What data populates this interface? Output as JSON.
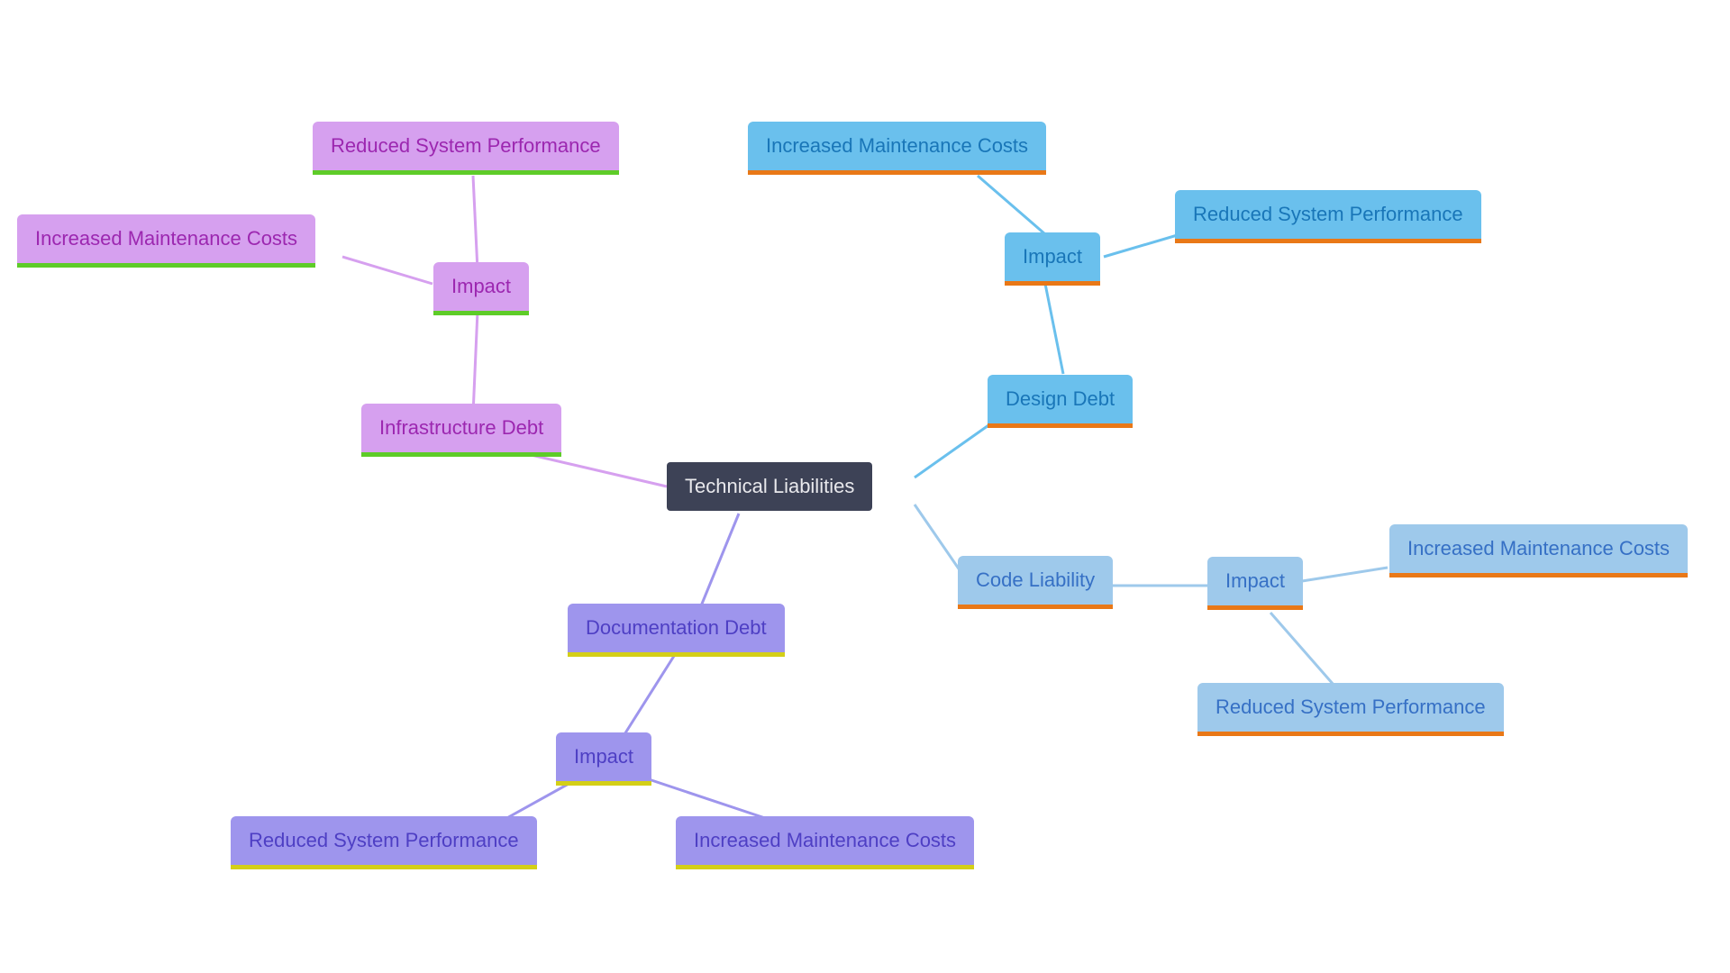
{
  "root": {
    "label": "Technical Liabilities"
  },
  "infrastructure": {
    "label": "Infrastructure Debt",
    "impact_label": "Impact",
    "item1": "Reduced System Performance",
    "item2": "Increased Maintenance Costs"
  },
  "design": {
    "label": "Design Debt",
    "impact_label": "Impact",
    "item1": "Increased Maintenance Costs",
    "item2": "Reduced System Performance"
  },
  "code": {
    "label": "Code Liability",
    "impact_label": "Impact",
    "item1": "Increased Maintenance Costs",
    "item2": "Reduced System Performance"
  },
  "documentation": {
    "label": "Documentation Debt",
    "impact_label": "Impact",
    "item1": "Reduced System Performance",
    "item2": "Increased Maintenance Costs"
  }
}
